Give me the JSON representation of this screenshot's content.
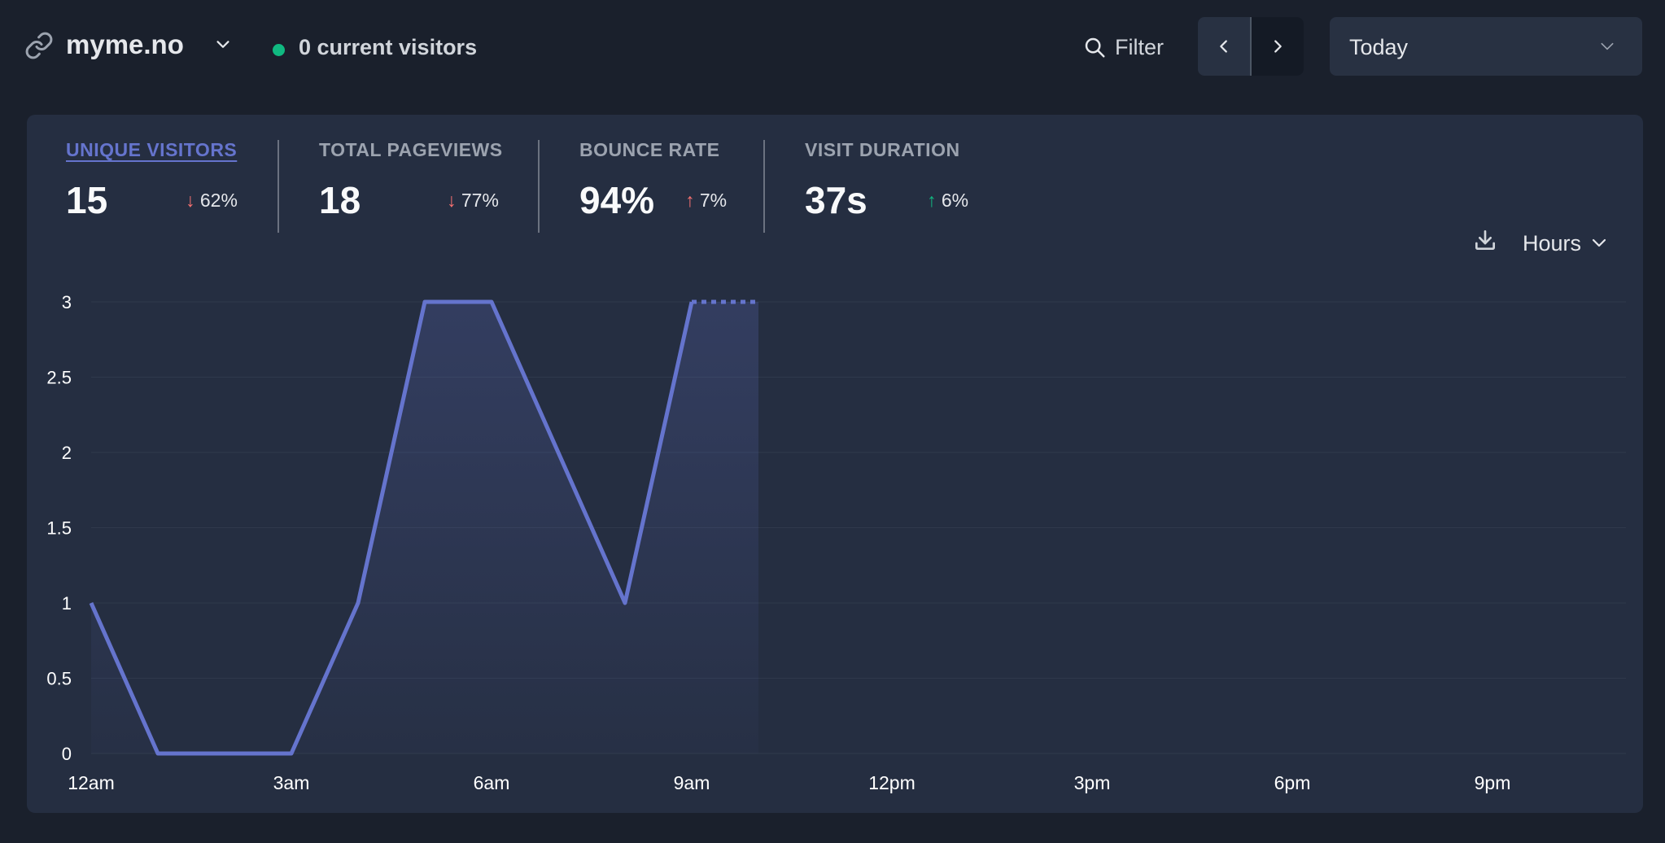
{
  "header": {
    "site_name": "myme.no",
    "current_visitors": "0 current visitors",
    "filter_label": "Filter",
    "period_label": "Today"
  },
  "colors": {
    "background": "#1a202c",
    "card": "#252e41",
    "accent": "#6574cd",
    "live": "#10b981",
    "down": "#f87171",
    "up": "#10b981"
  },
  "metrics": [
    {
      "label": "UNIQUE VISITORS",
      "value": "15",
      "change_arrow": "↓",
      "change": "62%",
      "direction": "down",
      "active": true
    },
    {
      "label": "TOTAL PAGEVIEWS",
      "value": "18",
      "change_arrow": "↓",
      "change": "77%",
      "direction": "down",
      "active": false
    },
    {
      "label": "BOUNCE RATE",
      "value": "94%",
      "change_arrow": "↑",
      "change": "7%",
      "direction": "up",
      "active": false
    },
    {
      "label": "VISIT DURATION",
      "value": "37s",
      "change_arrow": "↑",
      "change": "6%",
      "direction": "up",
      "active": false
    }
  ],
  "interval_label": "Hours",
  "icons": {
    "site": "link-icon",
    "site_menu": "chevron-down-icon",
    "filter": "search-icon",
    "prev": "chevron-left-icon",
    "next": "chevron-right-icon",
    "period_menu": "chevron-down-icon",
    "download": "download-icon",
    "interval_menu": "chevron-down-icon"
  },
  "chart_data": {
    "type": "area",
    "x_tick_labels": [
      "12am",
      "3am",
      "6am",
      "9am",
      "12pm",
      "3pm",
      "6pm",
      "9pm"
    ],
    "y_tick_labels": [
      "0",
      "0.5",
      "1",
      "1.5",
      "2",
      "2.5",
      "3"
    ],
    "ylim": [
      0,
      3
    ],
    "x_hours": [
      0,
      1,
      2,
      3,
      4,
      5,
      6,
      7,
      8,
      9,
      10
    ],
    "values": [
      1,
      0,
      0,
      0,
      1,
      3,
      3,
      2,
      1,
      3,
      3
    ],
    "dashed_from_hour": 9,
    "x_range_hours": [
      0,
      23
    ],
    "grid": true,
    "legend": "none"
  }
}
